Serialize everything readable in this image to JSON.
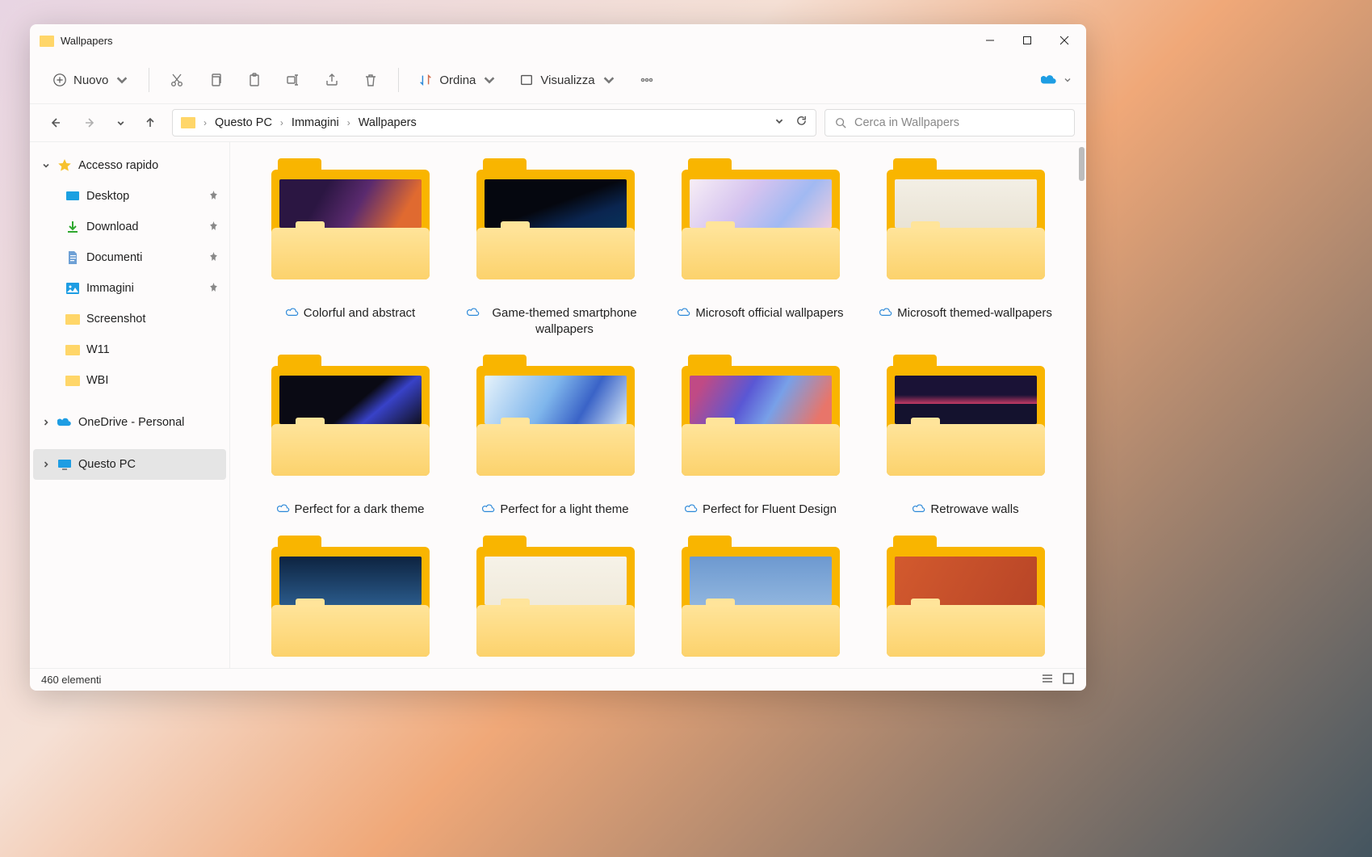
{
  "window": {
    "title": "Wallpapers"
  },
  "toolbar": {
    "new": "Nuovo",
    "sort": "Ordina",
    "view": "Visualizza"
  },
  "breadcrumb": {
    "root": "Questo PC",
    "p1": "Immagini",
    "p2": "Wallpapers"
  },
  "search": {
    "placeholder": "Cerca in Wallpapers"
  },
  "sidebar": {
    "quick": "Accesso rapido",
    "desktop": "Desktop",
    "download": "Download",
    "documents": "Documenti",
    "pictures": "Immagini",
    "screenshot": "Screenshot",
    "w11": "W11",
    "wbi": "WBI",
    "onedrive": "OneDrive - Personal",
    "thispc": "Questo PC"
  },
  "folders": {
    "f0": {
      "name": "Colorful and abstract",
      "preview": "linear-gradient(120deg,#2b1642 30%,#5a2a6e 55%,#e06a30 85%)"
    },
    "f1": {
      "name": "Game-themed smartphone wallpapers",
      "preview": "linear-gradient(160deg,#05070f 50%,#0a2550 75%,#08325a)"
    },
    "f2": {
      "name": "Microsoft official wallpapers",
      "preview": "linear-gradient(130deg,#f7eef6,#d5c3ef 40%,#a1b9f2 70%,#eecde0)"
    },
    "f3": {
      "name": "Microsoft themed-wallpapers",
      "preview": "linear-gradient(180deg,#f3efe5,#e9e3d5)"
    },
    "f4": {
      "name": "Perfect for a dark theme",
      "preview": "linear-gradient(140deg,#0a0a14 55%,#3842c8 70%,#101020)"
    },
    "f5": {
      "name": "Perfect for a light theme",
      "preview": "linear-gradient(120deg,#e7f3fb,#7fb6ec 45%,#3a63c7 70%,#d8e9f7)"
    },
    "f6": {
      "name": "Perfect for Fluent Design",
      "preview": "linear-gradient(120deg,#c04a85 10%,#5a57d4 40%,#78a0e8 60%,#e8756a 90%)"
    },
    "f7": {
      "name": "Retrowave walls",
      "preview": "linear-gradient(180deg,#1a1236 40%,#c23a64 58%,#14122e 58%)"
    },
    "f8": {
      "name": "",
      "preview": "linear-gradient(180deg,#0d2340,#2a5a8a)"
    },
    "f9": {
      "name": "",
      "preview": "linear-gradient(180deg,#f6f2e8,#f0eadb)"
    },
    "f10": {
      "name": "",
      "preview": "linear-gradient(180deg,#6d99d0,#90b5de)"
    },
    "f11": {
      "name": "",
      "preview": "linear-gradient(120deg,#d35a2e,#b84527)"
    }
  },
  "status": {
    "count": "460 elementi"
  }
}
